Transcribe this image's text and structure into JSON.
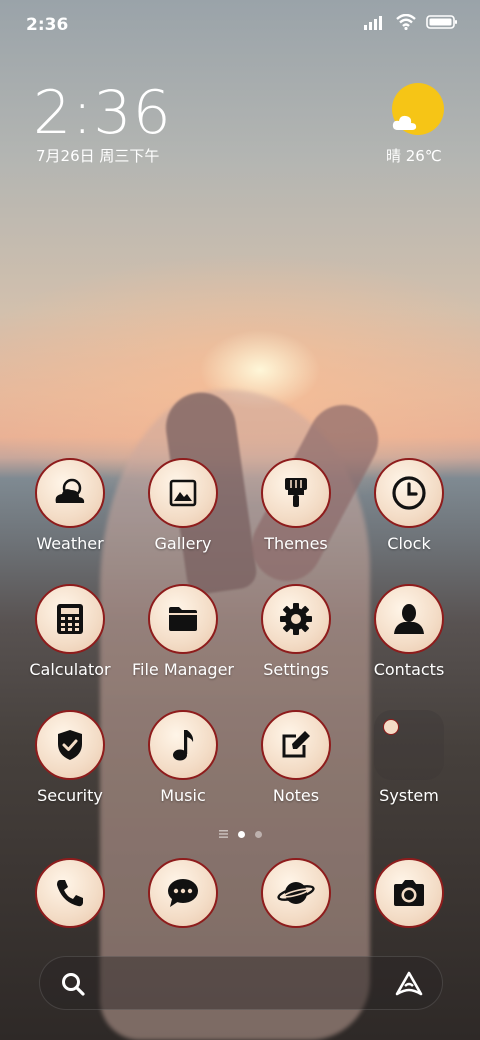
{
  "status": {
    "time": "2:36"
  },
  "widget": {
    "clock": "2:36",
    "date": "7月26日 周三下午",
    "weather": "晴 26℃"
  },
  "apps": [
    {
      "label": "Weather",
      "icon": "weather-icon"
    },
    {
      "label": "Gallery",
      "icon": "gallery-icon"
    },
    {
      "label": "Themes",
      "icon": "brush-icon"
    },
    {
      "label": "Clock",
      "icon": "clock-icon"
    },
    {
      "label": "Calculator",
      "icon": "calculator-icon"
    },
    {
      "label": "File Manager",
      "icon": "folder-icon"
    },
    {
      "label": "Settings",
      "icon": "gear-icon"
    },
    {
      "label": "Contacts",
      "icon": "person-icon"
    },
    {
      "label": "Security",
      "icon": "shield-icon"
    },
    {
      "label": "Music",
      "icon": "music-note-icon"
    },
    {
      "label": "Notes",
      "icon": "edit-note-icon"
    },
    {
      "label": "System",
      "icon": "folder-system-icon"
    }
  ],
  "dock": [
    {
      "icon": "phone-icon"
    },
    {
      "icon": "messages-icon"
    },
    {
      "icon": "browser-planet-icon"
    },
    {
      "icon": "camera-icon"
    }
  ],
  "colors": {
    "icon_border": "#8e1c1c",
    "sun": "#f6c516"
  }
}
